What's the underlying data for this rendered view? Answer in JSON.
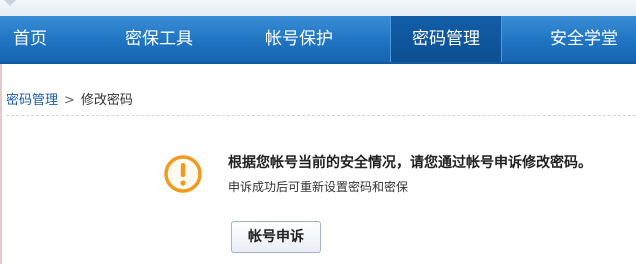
{
  "nav": {
    "items": [
      {
        "label": "首页"
      },
      {
        "label": "密保工具"
      },
      {
        "label": "帐号保护"
      },
      {
        "label": "密码管理"
      },
      {
        "label": "安全学堂"
      }
    ],
    "active_index": 3
  },
  "breadcrumb": {
    "parent": "密码管理",
    "separator": ">",
    "current": "修改密码"
  },
  "notice": {
    "title": "根据您帐号当前的安全情况，请您通过帐号申诉修改密码。",
    "subtitle": "申诉成功后可重新设置密码和密保",
    "button_label": "帐号申诉"
  },
  "colors": {
    "nav_blue": "#1f74c2",
    "warning_orange": "#f39a1e"
  },
  "icons": {
    "warning": "exclamation-circle-icon"
  }
}
